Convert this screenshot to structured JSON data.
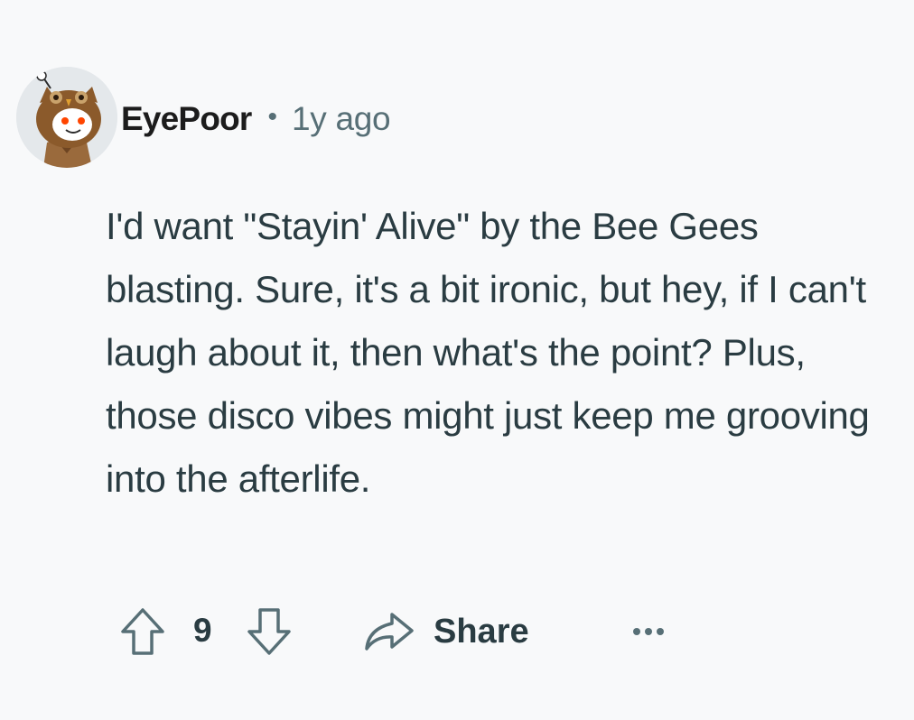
{
  "comment": {
    "username": "EyePoor",
    "separator": "•",
    "timestamp": "1y ago",
    "body": "I'd want \"Stayin' Alive\" by the Bee Gees blasting. Sure, it's a bit ironic, but hey, if I can't laugh about it, then what's the point? Plus, those disco vibes might just keep me grooving into the afterlife.",
    "score": "9"
  },
  "actions": {
    "share_label": "Share",
    "upvote_icon": "arrow-up-outline-icon",
    "downvote_icon": "arrow-down-outline-icon",
    "share_icon": "share-arrow-icon",
    "more_icon": "ellipsis-icon"
  },
  "avatar": {
    "description_icon": "snoo-owl-costume-avatar"
  },
  "colors": {
    "background": "#f8f9fa",
    "text_primary": "#2a3c42",
    "text_secondary": "#576f76",
    "username": "#1c1c1c"
  }
}
